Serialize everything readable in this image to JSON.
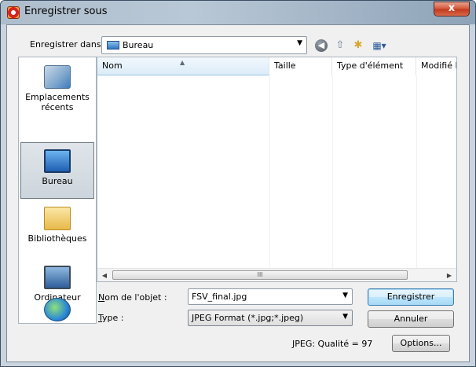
{
  "window": {
    "title": "Enregistrer sous",
    "close_label": "x"
  },
  "toolbar": {
    "save_in_label": "Enregistrer dans :",
    "save_in_value": "Bureau",
    "icons": [
      "back-icon",
      "up-folder-icon",
      "new-folder-icon",
      "views-menu-icon"
    ]
  },
  "places": [
    {
      "label": "Emplacements\nrécents",
      "icon": "recent-places-icon"
    },
    {
      "label": "Bureau",
      "icon": "desktop-icon",
      "selected": true
    },
    {
      "label": "Bibliothèques",
      "icon": "libraries-icon"
    },
    {
      "label": "Ordinateur",
      "icon": "computer-icon"
    },
    {
      "label": "",
      "icon": "network-icon"
    }
  ],
  "file_list": {
    "columns": [
      "Nom",
      "Taille",
      "Type d'élément",
      "Modifié le"
    ],
    "rows": [],
    "scroll_grip": "III"
  },
  "form": {
    "filename_label_u": "N",
    "filename_label": "om de l'objet :",
    "filename_value": "FSV_final.jpg",
    "type_label_u": "T",
    "type_label": "ype :",
    "type_value": "JPEG Format (*.jpg;*.jpeg)",
    "quality_text": "JPEG: Qualité = 97"
  },
  "buttons": {
    "save": "Enregistrer",
    "cancel": "Annuler",
    "options": "Options..."
  }
}
